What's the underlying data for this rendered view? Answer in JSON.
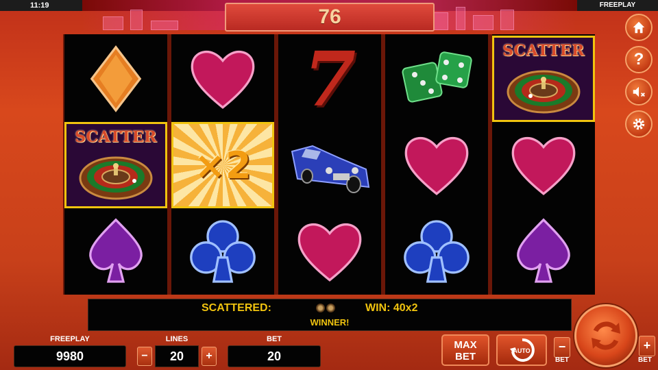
{
  "status_bar": {
    "time": "11:19",
    "mode": "FREEPLAY"
  },
  "counter": {
    "value": "76"
  },
  "reels": [
    [
      {
        "symbol": "diamond-icon",
        "highlight": false
      },
      {
        "symbol": "roulette-scatter-icon",
        "label": "SCATTER",
        "highlight": true
      },
      {
        "symbol": "spade-icon",
        "highlight": false
      }
    ],
    [
      {
        "symbol": "heart-icon",
        "highlight": false
      },
      {
        "symbol": "x2-multiplier",
        "label": "×2",
        "highlight": true
      },
      {
        "symbol": "club-icon",
        "highlight": false
      }
    ],
    [
      {
        "symbol": "seven-icon",
        "label": "7",
        "highlight": false
      },
      {
        "symbol": "car-icon",
        "highlight": false
      },
      {
        "symbol": "heart-icon",
        "highlight": false
      }
    ],
    [
      {
        "symbol": "dice-icon",
        "highlight": false
      },
      {
        "symbol": "heart-icon",
        "highlight": false
      },
      {
        "symbol": "club-icon",
        "highlight": false
      }
    ],
    [
      {
        "symbol": "roulette-scatter-icon",
        "label": "SCATTER",
        "highlight": true
      },
      {
        "symbol": "heart-icon",
        "highlight": false
      },
      {
        "symbol": "spade-icon",
        "highlight": false
      }
    ]
  ],
  "side_menu": [
    {
      "name": "home-icon"
    },
    {
      "name": "help-icon"
    },
    {
      "name": "sound-off-icon"
    },
    {
      "name": "settings-icon"
    }
  ],
  "win_bar": {
    "scattered_label": "SCATTERED:",
    "win_label": "WIN: 40x2",
    "winner_label": "WINNER!"
  },
  "bottom": {
    "freeplay_label": "FREEPLAY",
    "freeplay_value": "9980",
    "lines_label": "LINES",
    "lines_value": "20",
    "bet_label": "BET",
    "bet_value": "20",
    "minus": "−",
    "plus": "+",
    "max_bet_line1": "MAX",
    "max_bet_line2": "BET",
    "auto_label": "AUTO",
    "bet_minus_label": "BET",
    "bet_plus_label": "BET"
  },
  "colors": {
    "accent_yellow": "#f1c40f",
    "background_red": "#c8401a",
    "heart": "#c2185b",
    "suit_purple": "#7b1fa2",
    "club_blue": "#1e3fbf",
    "diamond_orange": "#e67e22"
  }
}
